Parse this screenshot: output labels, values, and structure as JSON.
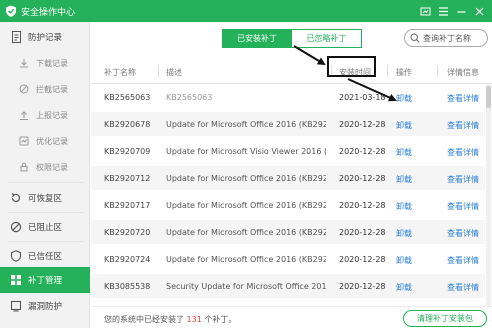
{
  "window": {
    "title": "安全操作中心",
    "controls": [
      "settings-icon",
      "skin-icon",
      "minimize-icon",
      "close-icon"
    ]
  },
  "sidebar": {
    "items": [
      {
        "label": "防护记录",
        "icon": "doc-icon",
        "type": "group"
      },
      {
        "label": "下载记录",
        "icon": "download-icon",
        "type": "sub"
      },
      {
        "label": "拦截记录",
        "icon": "block-icon",
        "type": "sub"
      },
      {
        "label": "上报记录",
        "icon": "upload-icon",
        "type": "sub"
      },
      {
        "label": "优化记录",
        "icon": "optimize-icon",
        "type": "sub"
      },
      {
        "label": "权限记录",
        "icon": "permission-icon",
        "type": "sub"
      },
      {
        "label": "可恢复区",
        "icon": "restore-icon",
        "type": "group"
      },
      {
        "label": "已阻止区",
        "icon": "blocked-icon",
        "type": "group"
      },
      {
        "label": "已信任区",
        "icon": "trust-icon",
        "type": "group"
      },
      {
        "label": "补丁管理",
        "icon": "patch-icon",
        "type": "group",
        "active": true
      },
      {
        "label": "漏洞防护",
        "icon": "shield-icon",
        "type": "group"
      }
    ]
  },
  "tabs": [
    {
      "label": "已安装补丁",
      "active": true
    },
    {
      "label": "已忽略补丁",
      "active": false
    }
  ],
  "search": {
    "placeholder": "查询补丁名称"
  },
  "table": {
    "headers": {
      "id": "补丁名称",
      "desc": "描述",
      "date": "安装时间",
      "action": "操作",
      "detail": "详情信息"
    },
    "rows": [
      {
        "id": "KB2565063",
        "desc": "KB2565063",
        "date": "2021-03-18",
        "action": "卸载",
        "detail": "查看详情"
      },
      {
        "id": "KB2920678",
        "desc": "Update for Microsoft Office 2016 (KB2920...",
        "date": "2020-12-28",
        "action": "卸载",
        "detail": "查看详情"
      },
      {
        "id": "KB2920709",
        "desc": "Update for Microsoft Visio Viewer 2016 (KB...",
        "date": "2020-12-28",
        "action": "卸载",
        "detail": "查看详情"
      },
      {
        "id": "KB2920712",
        "desc": "Update for Microsoft Office 2016 (KB2920...",
        "date": "2020-12-28",
        "action": "卸载",
        "detail": "查看详情"
      },
      {
        "id": "KB2920717",
        "desc": "Update for Microsoft Office 2016 (KB2920...",
        "date": "2020-12-28",
        "action": "卸载",
        "detail": "查看详情"
      },
      {
        "id": "KB2920720",
        "desc": "Update for Microsoft Office 2016 (KB2920...",
        "date": "2020-12-28",
        "action": "卸载",
        "detail": "查看详情"
      },
      {
        "id": "KB2920724",
        "desc": "Update for Microsoft Office 2016 (KB2920...",
        "date": "2020-12-28",
        "action": "卸载",
        "detail": "查看详情"
      },
      {
        "id": "KB3085538",
        "desc": "Security Update for Microsoft Office 2016 ...",
        "date": "2020-12-28",
        "action": "卸载",
        "detail": "查看详情"
      }
    ]
  },
  "footer": {
    "prefix": "您的系统中已经安装了",
    "count": "131",
    "suffix": "个补丁。",
    "clean_button": "清理补丁安装包"
  },
  "colors": {
    "accent": "#24b15a",
    "link": "#2a7fd8",
    "count": "#e04343"
  }
}
